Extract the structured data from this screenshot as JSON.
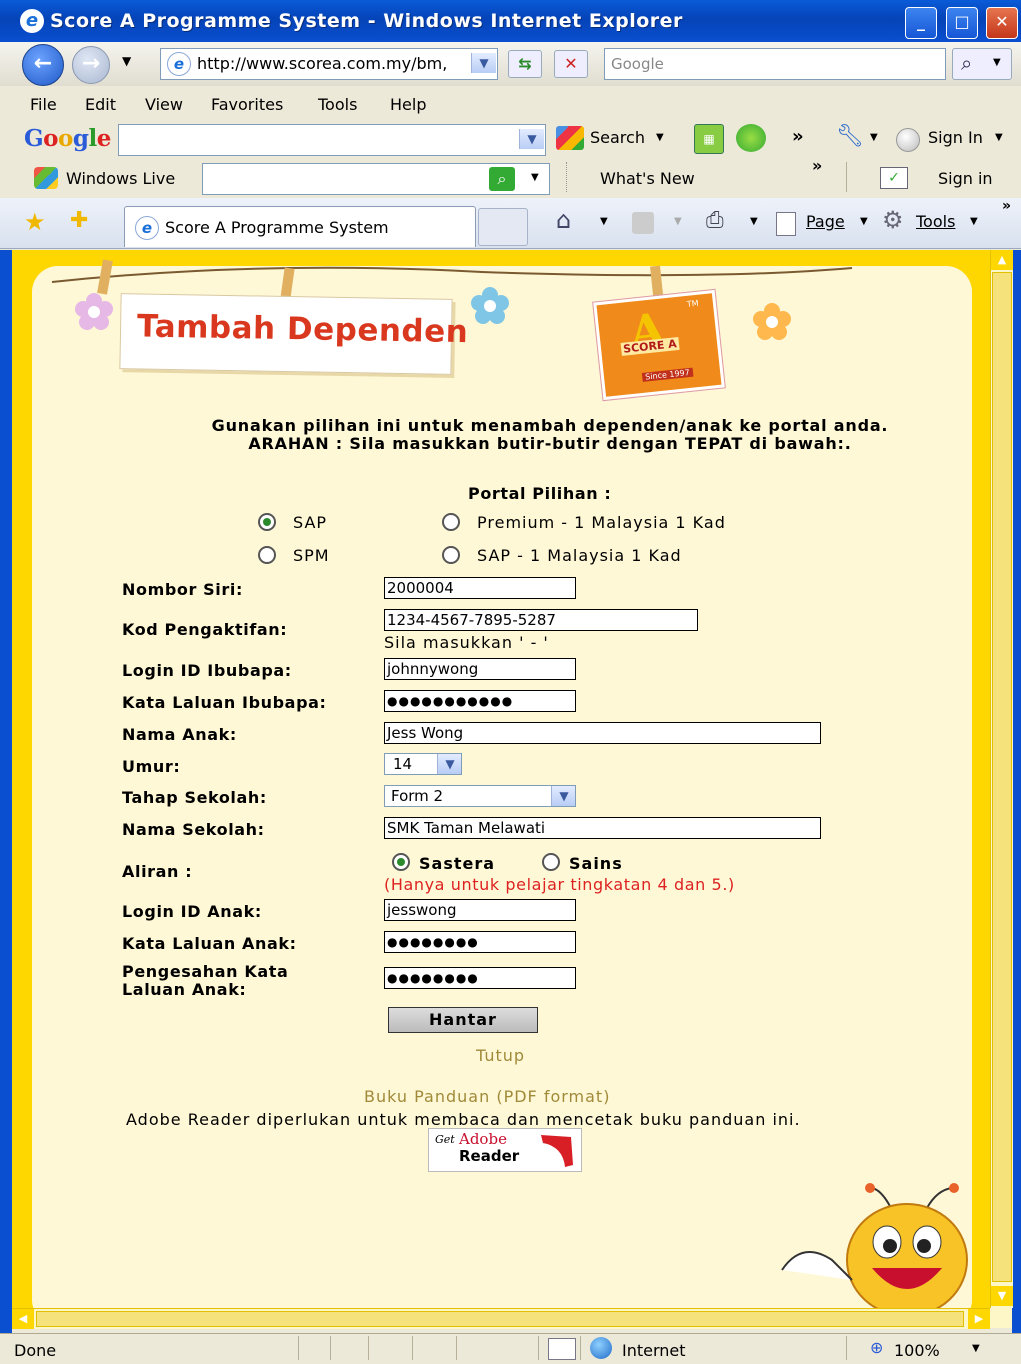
{
  "window": {
    "title": "Score A Programme System - Windows Internet Explorer"
  },
  "address": {
    "url": "http://www.scorea.com.my/bm,",
    "search_placeholder": "Google"
  },
  "menu": [
    "File",
    "Edit",
    "View",
    "Favorites",
    "Tools",
    "Help"
  ],
  "google_toolbar": {
    "logo": "Google",
    "search_label": "Search",
    "sign_in": "Sign In"
  },
  "wlive_toolbar": {
    "label": "Windows Live",
    "whats_new": "What's New",
    "sign_in": "Sign in"
  },
  "tab": {
    "label": "Score A Programme System",
    "page_label": "Page",
    "tools_label": "Tools"
  },
  "page": {
    "heading": "Tambah Dependen",
    "logo_text": "SCORE A",
    "logo_tm": "TM",
    "logo_since": "Since 1997",
    "intro_line1": "Gunakan pilihan ini untuk menambah dependen/anak ke portal anda.",
    "intro_line2": "ARAHAN : Sila masukkan butir-butir dengan TEPAT di bawah:.",
    "portal_title": "Portal Pilihan :",
    "portal_options": [
      "SAP",
      "Premium - 1 Malaysia 1 Kad",
      "SPM",
      "SAP - 1 Malaysia 1 Kad"
    ],
    "portal_selected": "SAP",
    "fields": {
      "nombor_siri": {
        "label": "Nombor Siri:",
        "value": "2000004"
      },
      "kod_pengaktifan": {
        "label": "Kod Pengaktifan:",
        "value": "1234-4567-7895-5287",
        "hint": "Sila masukkan ' - '"
      },
      "login_ibubapa": {
        "label": "Login ID Ibubapa:",
        "value": "johnnywong"
      },
      "kata_laluan_ibubapa": {
        "label": "Kata Laluan Ibubapa:",
        "value": "●●●●●●●●●●●"
      },
      "nama_anak": {
        "label": "Nama Anak:",
        "value": "Jess Wong"
      },
      "umur": {
        "label": "Umur:",
        "value": "14"
      },
      "tahap_sekolah": {
        "label": "Tahap Sekolah:",
        "value": "Form 2"
      },
      "nama_sekolah": {
        "label": "Nama Sekolah:",
        "value": "SMK Taman Melawati"
      },
      "aliran": {
        "label": "Aliran :",
        "option1": "Sastera",
        "option2": "Sains",
        "note": "(Hanya untuk pelajar tingkatan 4 dan 5.)",
        "selected": "Sastera"
      },
      "login_anak": {
        "label": "Login ID Anak:",
        "value": "jesswong"
      },
      "kata_laluan_anak": {
        "label": "Kata Laluan Anak:",
        "value": "●●●●●●●●"
      },
      "pengesahan_line1": "Pengesahan Kata",
      "pengesahan_line2": "Laluan Anak:",
      "pengesahan_value": "●●●●●●●●"
    },
    "submit_label": "Hantar",
    "close_link": "Tutup",
    "guide_link": "Buku Panduan (PDF format)",
    "adobe_note": "Adobe Reader diperlukan untuk membaca dan mencetak buku panduan ini.",
    "adobe_badge_get": "Get",
    "adobe_badge_adobe": "Adobe",
    "adobe_badge_reader": "Reader"
  },
  "status": {
    "text": "Done",
    "zone": "Internet",
    "zoom": "100%"
  },
  "colors": {
    "frame_yellow": "#FFD700",
    "card_bg": "#FFF8D6",
    "heading_red": "#D9381E",
    "hint_red": "#D22",
    "link_olive": "#A08A3A"
  }
}
